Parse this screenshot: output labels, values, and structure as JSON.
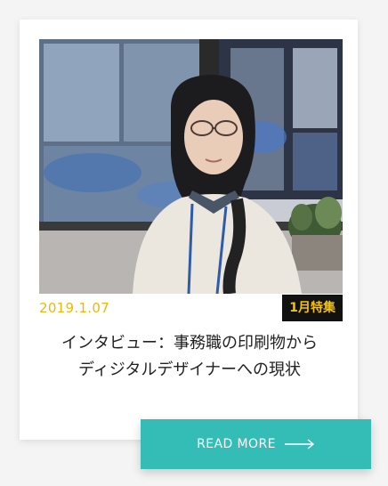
{
  "card": {
    "date": "2019.1.07",
    "category": "1月特集",
    "title_line1": "インタビュー：事務職の印刷物から",
    "title_line2": "ディジタルデザイナーへの現状",
    "read_more_label": "READ MORE"
  },
  "colors": {
    "accent": "#33bdb6",
    "date": "#f0b800",
    "badge_bg": "#111111",
    "badge_text": "#f5c400"
  },
  "icons": {
    "read_more_arrow": "long-arrow-right-icon"
  }
}
